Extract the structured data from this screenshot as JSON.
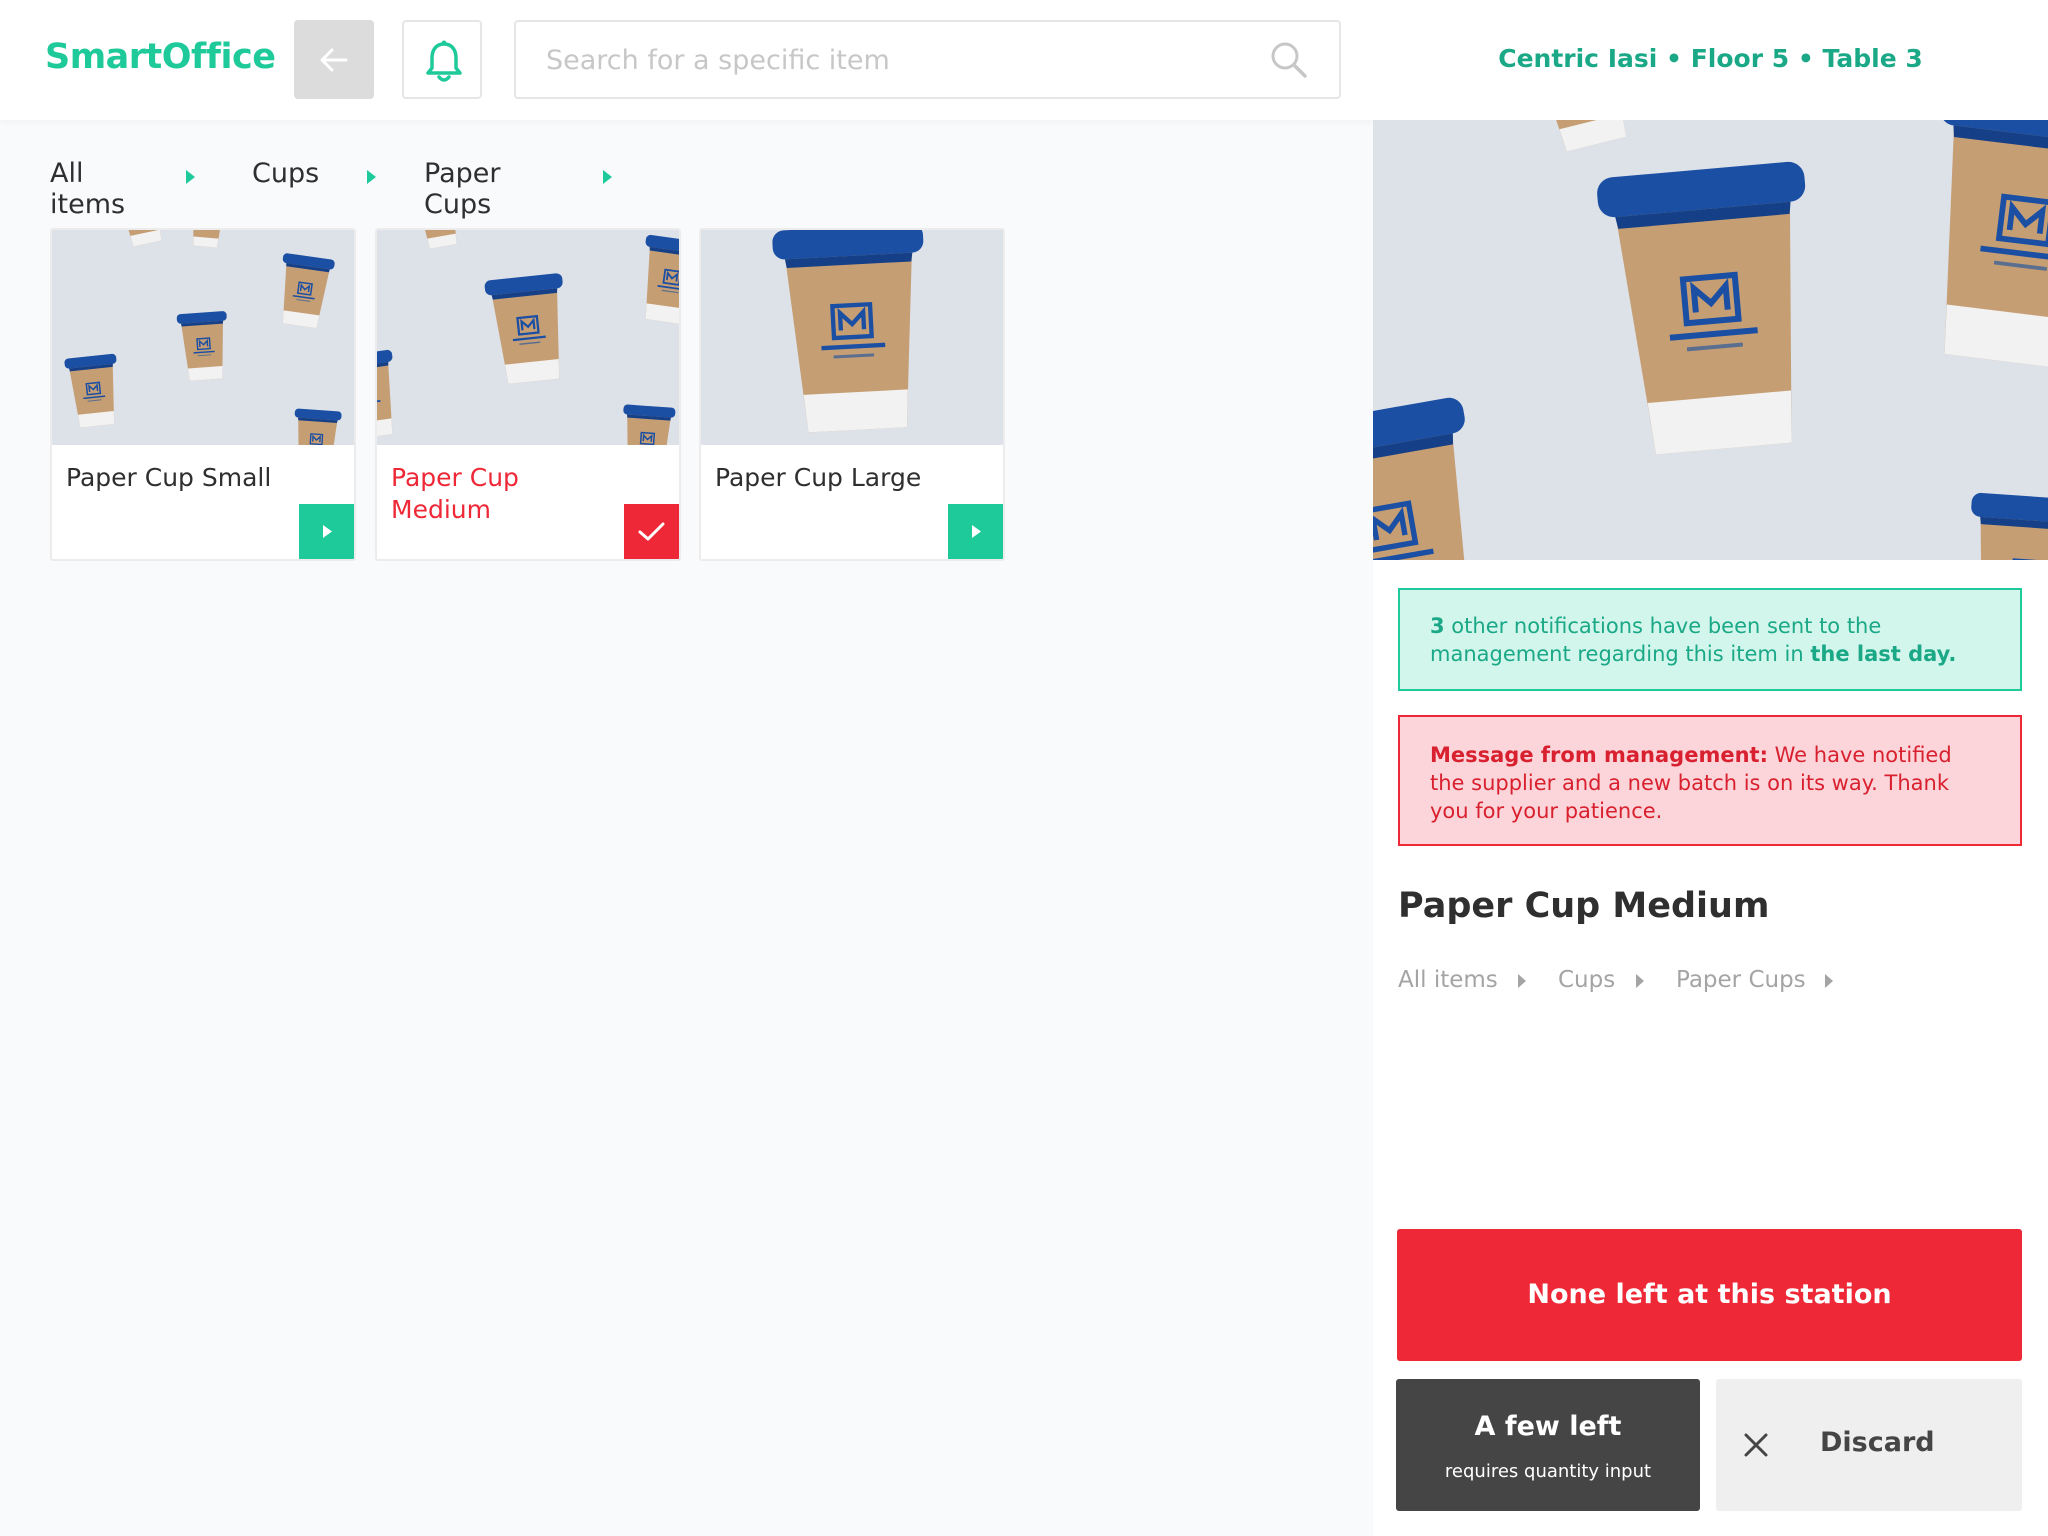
{
  "app": {
    "title": "SmartOffice"
  },
  "header": {
    "search_placeholder": "Search for a specific item",
    "location": "Centric Iasi • Floor 5 • Table 3"
  },
  "breadcrumb": [
    "All items",
    "Cups",
    "Paper Cups"
  ],
  "items": [
    {
      "name": "Paper Cup Small",
      "selected": false
    },
    {
      "name": "Paper Cup Medium",
      "selected": true
    },
    {
      "name": "Paper Cup Large",
      "selected": false
    }
  ],
  "detail": {
    "notice": {
      "count": "3",
      "text": " other notifications have been sent to the management regarding this item in ",
      "emphasis": "the last day."
    },
    "message": {
      "label": "Message from management:",
      "text": " We have notified the supplier and a new batch is on its way. Thank you for your patience."
    },
    "title": "Paper Cup Medium",
    "breadcrumb": [
      "All items",
      "Cups",
      "Paper Cups"
    ]
  },
  "actions": {
    "none_left": "None left at this station",
    "few_left": "A few left",
    "few_left_sub": "requires quantity input",
    "discard": "Discard"
  },
  "colors": {
    "accent": "#1ec99a",
    "danger": "#ee2836",
    "dark": "#454545"
  },
  "icons": [
    "arrow-left-icon",
    "bell-icon",
    "search-icon",
    "play-icon",
    "check-icon",
    "close-icon"
  ]
}
